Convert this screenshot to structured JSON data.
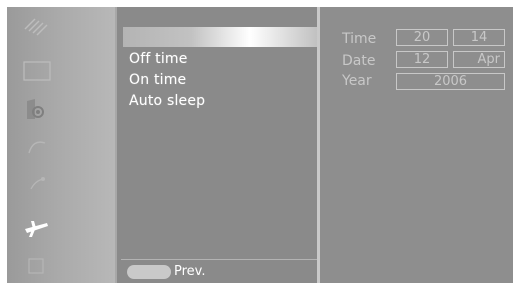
{
  "sidebar": {
    "icons": [
      "setup-icon",
      "picture-icon",
      "sound-icon",
      "features-icon",
      "channels-icon",
      "installation-icon",
      "input-icon"
    ]
  },
  "menu": {
    "items": [
      {
        "label": ""
      },
      {
        "label": "Off time"
      },
      {
        "label": "On time"
      },
      {
        "label": "Auto sleep"
      }
    ],
    "prev_label": "Prev."
  },
  "settings": {
    "time": {
      "label": "Time",
      "hours": "20",
      "minutes": "14"
    },
    "date": {
      "label": "Date",
      "day": "12",
      "month": "Apr"
    },
    "year": {
      "label": "Year",
      "value": "2006"
    }
  }
}
